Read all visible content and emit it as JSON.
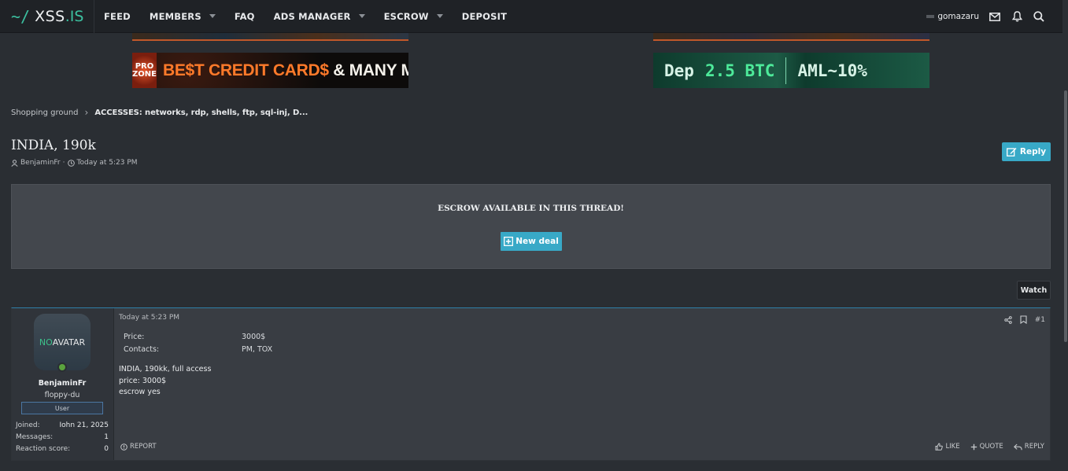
{
  "logo": {
    "tilde": "~/",
    "xss": "XSS",
    "is": ".IS"
  },
  "nav": [
    {
      "label": "FEED",
      "caret": false
    },
    {
      "label": "MEMBERS",
      "caret": true
    },
    {
      "label": "FAQ",
      "caret": false
    },
    {
      "label": "ADS MANAGER",
      "caret": true
    },
    {
      "label": "ESCROW",
      "caret": true
    },
    {
      "label": "DEPOSIT",
      "caret": false
    }
  ],
  "user": {
    "name": "gomazaru"
  },
  "banners": {
    "left": {
      "logo_top": "PRO",
      "logo_bottom": "ZONE",
      "text_a": "BE",
      "text_b": "$",
      "text_c": "T CREDIT CARD",
      "text_d": "$",
      "text_e": " & MANY MORE"
    },
    "right": {
      "dep": "Dep",
      "amount": "2.5 BTC",
      "aml": "AML~10%"
    }
  },
  "breadcrumb": {
    "parent": "Shopping ground",
    "current": "ACCESSES: networks, rdp, shells, ftp, sql-inj, D..."
  },
  "thread": {
    "title": "INDIA, 190k",
    "author": "BenjaminFr",
    "time": "Today at 5:23 PM",
    "reply_label": "Reply"
  },
  "escrow": {
    "title": "ESCROW AVAILABLE IN THIS THREAD!",
    "button": "New deal"
  },
  "watch_label": "Watch",
  "post": {
    "user": {
      "avatar_no": "NO",
      "avatar_text": " AVATAR",
      "name": "BenjaminFr",
      "title": "floppy-du",
      "badge": "User",
      "stats": [
        {
          "label": "Joined:",
          "value": "Iohn 21, 2025"
        },
        {
          "label": "Messages:",
          "value": "1"
        },
        {
          "label": "Reaction score:",
          "value": "0"
        }
      ]
    },
    "date": "Today at 5:23 PM",
    "number": "#1",
    "fields": [
      {
        "key": "Price:",
        "value": "3000$"
      },
      {
        "key": "Contacts:",
        "value": "PM, TOX"
      }
    ],
    "body": [
      "INDIA, 190kk, full access",
      "price: 3000$",
      "escrow yes"
    ],
    "report_label": "REPORT",
    "actions": {
      "like": "LIKE",
      "quote": "QUOTE",
      "reply": "REPLY"
    }
  },
  "colors": {
    "accent": "#38a9c7",
    "background": "#2a2e33",
    "topbar": "#1f2226",
    "logo_green": "#3cc0a0"
  }
}
